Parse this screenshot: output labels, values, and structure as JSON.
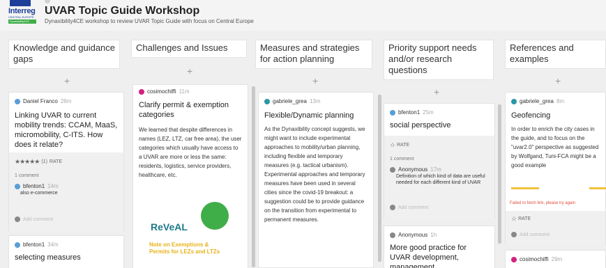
{
  "header": {
    "logo_text": "Interreg",
    "logo_sub": "CENTRAL EUROPE",
    "logo_badge": "Dynaxibility4CE",
    "title": "UVAR Topic Guide Workshop",
    "subtitle": "Dynaxibility4CE workshop to review UVAR Topic Guide with focus on Central Europe"
  },
  "columns": [
    {
      "heading": "Knowledge and guidance gaps",
      "cards": [
        {
          "author": "Daniel Franco",
          "ago": "28m",
          "title": "Linking UVAR to current mobility trends: CCAM, MaaS, micromobility, C-ITS. How does it relate?",
          "rating": "(1)",
          "rate_label": "RATE",
          "comments_count": "1 comment",
          "comment": {
            "author": "bfenton1",
            "ago": "14m",
            "text": "also e-commerce"
          },
          "add_comment": "Add comment"
        },
        {
          "author": "bfenton1",
          "ago": "34m",
          "title": "selecting measures"
        }
      ]
    },
    {
      "heading": "Challenges and Issues",
      "cards": [
        {
          "author": "cosimochiffi",
          "ago": "11m",
          "title": "Clarify permit & exemption categories",
          "body": "We learned that despite differences in names (LEZ, LTZ, car free area), the user categories which usually have access to a UVAR are more or less the same: residents, logistics, service providers, healthcare, etc.",
          "image_logo": "ReVeAL",
          "image_note": "Note on Exemptions & Permits for LEZs and LTZs"
        }
      ]
    },
    {
      "heading": "Measures and strategies for action planning",
      "cards": [
        {
          "author": "gabriele_grea",
          "ago": "13m",
          "title": "Flexible/Dynamic planning",
          "body": "As the Dynaxibility concept suggests, we might want to include experimental approaches to mobility/urban planning, including flexible and temporary measures (e.g. tactical urbanism). Experimental approaches and temporary measures have been used in several cities since the covid-19 breakout: a suggestion could be to provide guidance on the transition from experimental to permanent measures."
        }
      ]
    },
    {
      "heading": "Priority support needs and/or research questions",
      "cards": [
        {
          "author": "bfenton1",
          "ago": "25m",
          "title": "social perspective",
          "rate_label": "RATE",
          "comments_count": "1 comment",
          "comment": {
            "author": "Anonymous",
            "ago": "17m",
            "text": "Definition of which kind of data are useful needed for each different kind of UVAR"
          },
          "add_comment": "Add comment"
        },
        {
          "author": "Anonymous",
          "ago": "1h",
          "title": "More good practice for UVAR development, management"
        }
      ]
    },
    {
      "heading": "References and examples",
      "cards": [
        {
          "author": "gabriele_grea",
          "ago": "8m",
          "title": "Geofencing",
          "body": "In order to enrich the city cases in the guide, and to focus on the \"uvar2.0\" perspective as suggested by Wolfgand, Tuni-FCA might be a good example",
          "error": "Failed to fetch link, please try again",
          "rate_label": "RATE",
          "add_comment": "Add comment"
        },
        {
          "author": "cosimochiffi",
          "ago": "29m"
        }
      ]
    }
  ],
  "plus": "+",
  "stars": "★★★★★",
  "star_outline": "☆"
}
